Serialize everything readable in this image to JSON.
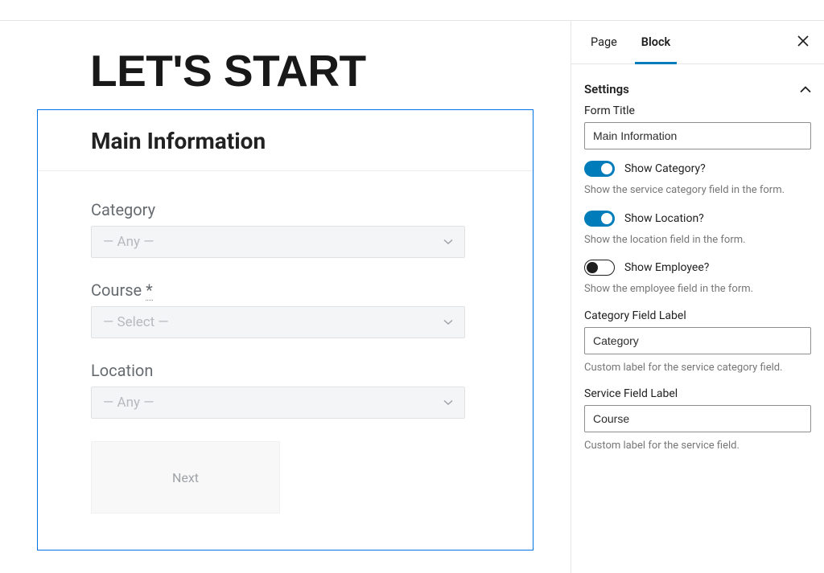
{
  "page_heading": "LET'S START",
  "form": {
    "title": "Main Information",
    "fields": {
      "category": {
        "label": "Category",
        "placeholder": "— Any —"
      },
      "service": {
        "label": "Course",
        "required_mark": "*",
        "placeholder": "— Select —"
      },
      "location": {
        "label": "Location",
        "placeholder": "— Any —"
      }
    },
    "next_label": "Next"
  },
  "sidebar": {
    "tabs": {
      "page": "Page",
      "block": "Block"
    },
    "panel_title": "Settings",
    "controls": {
      "form_title": {
        "label": "Form Title",
        "value": "Main Information"
      },
      "show_category": {
        "label": "Show Category?",
        "on": true,
        "help": "Show the service category field in the form."
      },
      "show_location": {
        "label": "Show Location?",
        "on": true,
        "help": "Show the location field in the form."
      },
      "show_employee": {
        "label": "Show Employee?",
        "on": false,
        "help": "Show the employee field in the form."
      },
      "category_field_label": {
        "label": "Category Field Label",
        "value": "Category",
        "help": "Custom label for the service category field."
      },
      "service_field_label": {
        "label": "Service Field Label",
        "value": "Course",
        "help": "Custom label for the service field."
      }
    }
  }
}
